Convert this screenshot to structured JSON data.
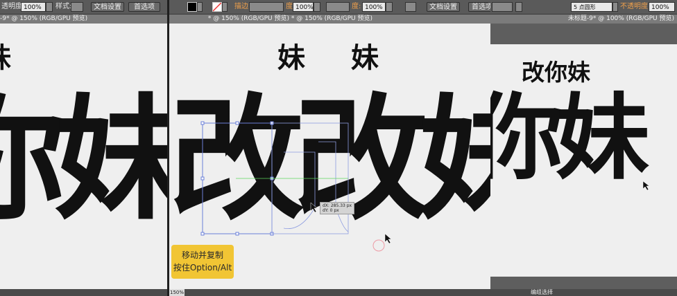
{
  "panel_left": {
    "toolbar": {
      "opacity_label": "透明度:",
      "opacity_value": "100%",
      "style_label": "样式:",
      "doc_settings": "文档设置",
      "preferences": "首选项"
    },
    "status": "-9* @ 150% (RGB/GPU 预览)",
    "art_small": "妹",
    "art_big": "改你妹"
  },
  "panel_mid": {
    "toolbar": {
      "stroke_label": "描边:",
      "opacity_label": "度:",
      "opacity_value": "100%",
      "opacity_label2": "度:",
      "opacity_value2": "100%",
      "doc_settings": "文档设置",
      "preferences": "首选项"
    },
    "status": "* @ 150% (RGB/GPU 预览) * @ 150% (RGB/GPU 预览)",
    "art_small": "妹",
    "art_big": "改改妹",
    "tooltip": {
      "dx": "dX: 285.33 px",
      "dy": "dY: 0 px"
    },
    "hint": {
      "line1": "移动并复制",
      "line2": "按住Option/Alt"
    },
    "zoom": "150%"
  },
  "panel_right": {
    "toolbar": {
      "brush_value": "5 点圆形",
      "opacity_label": "不透明度:",
      "opacity_value": "100%"
    },
    "status": "未标题-9* @ 100% (RGB/GPU 预览)",
    "art_small": "改你妹",
    "art_big": "你妹",
    "bottom_label": "编组选择"
  }
}
